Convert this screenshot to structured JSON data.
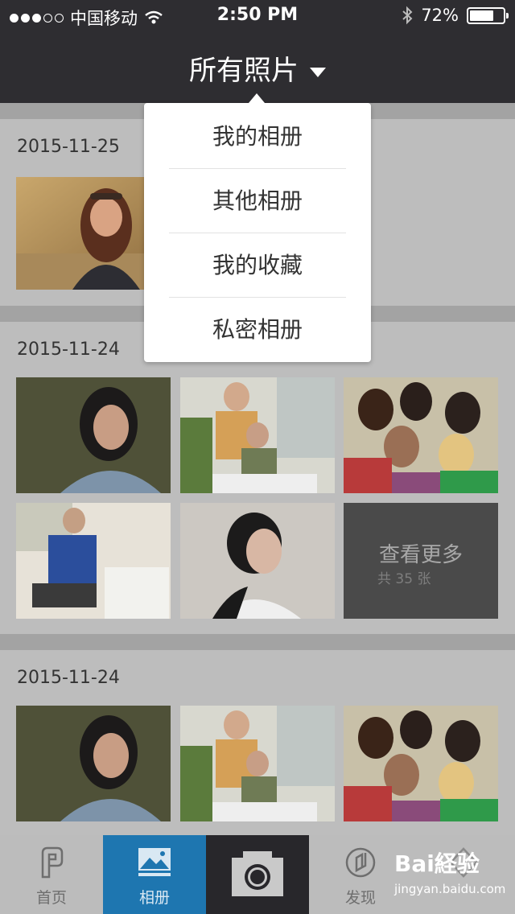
{
  "status": {
    "carrier": "中国移动",
    "time": "2:50 PM",
    "battery": "72%",
    "battery_level": 0.72
  },
  "header": {
    "title": "所有照片"
  },
  "dropdown": {
    "items": [
      "我的相册",
      "其他相册",
      "我的收藏",
      "私密相册"
    ]
  },
  "sections": [
    {
      "date": "2015-11-25"
    },
    {
      "date": "2015-11-24",
      "more_label": "查看更多",
      "count_label": "共 35 张"
    },
    {
      "date": "2015-11-24"
    }
  ],
  "tabs": [
    {
      "label": "首页",
      "icon": "home-icon"
    },
    {
      "label": "相册",
      "icon": "album-icon"
    },
    {
      "label": "",
      "icon": "camera-icon"
    },
    {
      "label": "发现",
      "icon": "discover-icon"
    },
    {
      "label": "",
      "icon": "profile-icon"
    }
  ],
  "watermark": {
    "brand": "Bai経验",
    "url": "jingyan.baidu.com"
  }
}
